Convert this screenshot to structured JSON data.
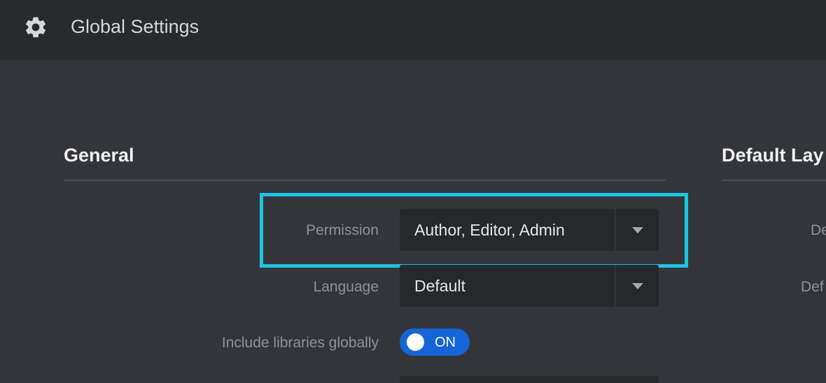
{
  "app": {
    "title": "Global Settings",
    "icon": "gear-icon"
  },
  "sections": {
    "general": {
      "title": "General",
      "rows": {
        "permission": {
          "label": "Permission",
          "value": "Author, Editor, Admin"
        },
        "language": {
          "label": "Language",
          "value": "Default"
        },
        "include_libraries": {
          "label": "Include libraries globally",
          "state": "ON"
        }
      }
    },
    "default_layout": {
      "title": "Default Lay",
      "rows": [
        {
          "label": "De"
        },
        {
          "label": "Def"
        }
      ]
    }
  },
  "colors": {
    "highlight": "#1dc5e3",
    "toggle_on": "#1565d8",
    "background": "#34353a",
    "topbar": "#292a2e"
  }
}
